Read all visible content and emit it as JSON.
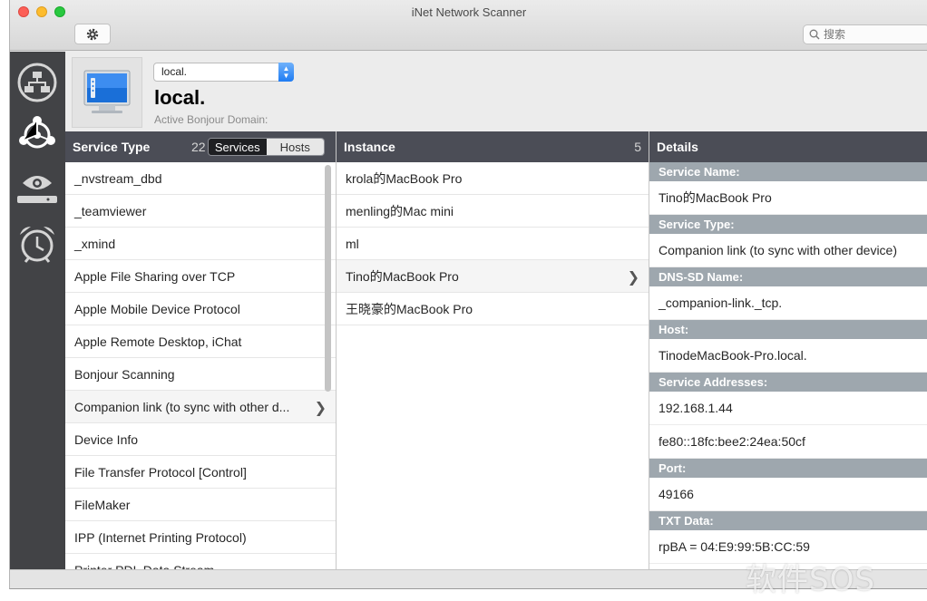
{
  "window": {
    "title": "iNet Network Scanner"
  },
  "toolbar": {
    "search_placeholder": "搜索"
  },
  "domain": {
    "selected": "local.",
    "title": "local.",
    "subtitle": "Active Bonjour Domain:"
  },
  "service_type": {
    "header": "Service Type",
    "count": "22",
    "segment_services": "Services",
    "segment_hosts": "Hosts",
    "items": [
      "_nvstream_dbd",
      "_teamviewer",
      "_xmind",
      "Apple File Sharing over TCP",
      "Apple Mobile Device Protocol",
      "Apple Remote Desktop, iChat",
      "Bonjour Scanning",
      "Companion link (to sync with other d...",
      "Device Info",
      "File Transfer Protocol [Control]",
      "FileMaker",
      "IPP (Internet Printing Protocol)",
      "Printer PDL Data Stream"
    ]
  },
  "instance": {
    "header": "Instance",
    "count": "5",
    "items": [
      "krola的MacBook Pro",
      "menling的Mac mini",
      "ml",
      "Tino的MacBook Pro",
      "王晓豪的MacBook Pro"
    ]
  },
  "details": {
    "header": "Details",
    "service_name_label": "Service Name:",
    "service_name": "Tino的MacBook Pro",
    "service_type_label": "Service Type:",
    "service_type": "Companion link (to sync with other device)",
    "dnssd_label": "DNS-SD Name:",
    "dnssd": "_companion-link._tcp.",
    "host_label": "Host:",
    "host": "TinodeMacBook-Pro.local.",
    "addresses_label": "Service Addresses:",
    "address_v4": "192.168.1.44",
    "address_v6": "fe80::18fc:bee2:24ea:50cf",
    "port_label": "Port:",
    "port": "49166",
    "txt_label": "TXT Data:",
    "txt": "rpBA = 04:E9:99:5B:CC:59"
  },
  "watermark": "软件SOS",
  "icons": {
    "settings": "gear-icon",
    "search": "search-icon",
    "sidebar": [
      "network-icon",
      "bonjour-icon",
      "watch-icon",
      "alarm-clock-icon"
    ],
    "domain": "computer-display-icon"
  }
}
